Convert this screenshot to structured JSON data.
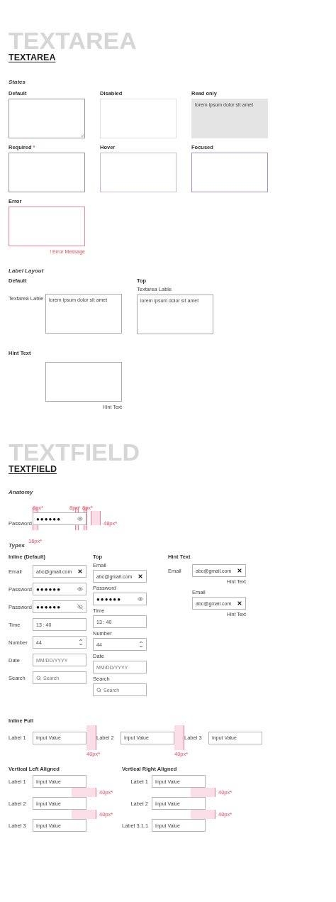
{
  "textarea": {
    "background_title": "TEXTAREA",
    "title": "TEXTAREA",
    "states": {
      "heading": "States",
      "items": [
        {
          "label": "Default",
          "kind": "default"
        },
        {
          "label": "Disabled",
          "kind": "disabled"
        },
        {
          "label": "Read only",
          "kind": "readonly",
          "value": "lorem ipsum dolor sit amet"
        },
        {
          "label": "Required",
          "required_mark": "*",
          "kind": "required"
        },
        {
          "label": "Hover",
          "kind": "hover"
        },
        {
          "label": "Focused",
          "kind": "focused"
        },
        {
          "label": "Error",
          "kind": "error",
          "message": "! Error Message"
        }
      ]
    },
    "label_layout": {
      "heading": "Label Layout",
      "default": {
        "heading": "Default",
        "label": "Textarea Lable",
        "value": "lorem ipsum dolor sit amet"
      },
      "top": {
        "heading": "Top",
        "label": "Textarea Lable",
        "value": "lorem ipsum dolor sit amet"
      }
    },
    "hint": {
      "heading": "Hint Text",
      "hint": "Hint Text"
    }
  },
  "textfield": {
    "background_title": "TEXTFIELD",
    "title": "TEXTFIELD",
    "anatomy": {
      "heading": "Anatomy",
      "label": "Password",
      "value": "●●●●●●",
      "annotations": {
        "padding_left": "8px*",
        "icon_left": "8px*",
        "icon_right": "8px*",
        "height": "48px*",
        "label_gap": "16px*"
      }
    },
    "types": {
      "heading": "Types",
      "inline": {
        "heading": "Inline (Default)",
        "fields": [
          {
            "label": "Email",
            "kind": "email",
            "value": "abc@gmail.com"
          },
          {
            "label": "Password",
            "kind": "password",
            "value": "●●●●●●"
          },
          {
            "label": "Password",
            "kind": "password_hidden",
            "value": "●●●●●●"
          },
          {
            "label": "Time",
            "kind": "time",
            "value": "13 : 40"
          },
          {
            "label": "Number",
            "kind": "number",
            "value": "44"
          },
          {
            "label": "Date",
            "kind": "date",
            "placeholder": "MM/DD/YYYY"
          },
          {
            "label": "Search",
            "kind": "search",
            "placeholder": "Search"
          }
        ]
      },
      "top": {
        "heading": "Top",
        "fields": [
          {
            "label": "Email",
            "kind": "email",
            "value": "abc@gmail.com"
          },
          {
            "label": "Password",
            "kind": "password",
            "value": "●●●●●●"
          },
          {
            "label": "Time",
            "kind": "time",
            "value": "13 : 40"
          },
          {
            "label": "Number",
            "kind": "number",
            "value": "44"
          },
          {
            "label": "Date",
            "kind": "date",
            "placeholder": "MM/DD/YYYY"
          },
          {
            "label": "Search",
            "kind": "search",
            "placeholder": "Search"
          }
        ]
      },
      "hint": {
        "heading": "Hint Text",
        "inline_field": {
          "label": "Email",
          "kind": "email",
          "value": "abc@gmail.com",
          "hint": "Hint Text"
        },
        "top_field": {
          "label": "Email",
          "kind": "email",
          "value": "abc@gmail.com",
          "hint": "Hint Text"
        }
      }
    },
    "inline_full": {
      "heading": "Inline Full",
      "fields": [
        {
          "label": "Label 1",
          "value": "Input Value",
          "spacing": "40px*"
        },
        {
          "label": "Label 2",
          "value": "Input Value",
          "spacing": "40px*"
        },
        {
          "label": "Label 3",
          "value": "Input Value"
        }
      ]
    },
    "vertical_left": {
      "heading": "Vertical Left Aligned",
      "fields": [
        {
          "label": "Label 1",
          "value": "Input Value",
          "spacing": "40px*"
        },
        {
          "label": "Label 2",
          "value": "Input Value",
          "spacing": "40px*"
        },
        {
          "label": "Label 3",
          "value": "Input Value"
        }
      ]
    },
    "vertical_right": {
      "heading": "Vertical Right Aligned",
      "fields": [
        {
          "label": "Label 1",
          "value": "Input Value",
          "spacing": "40px*"
        },
        {
          "label": "Label 2",
          "value": "Input Value",
          "spacing": "40px*"
        },
        {
          "label": "Label 3.1.1",
          "value": "Input Value"
        }
      ]
    }
  }
}
